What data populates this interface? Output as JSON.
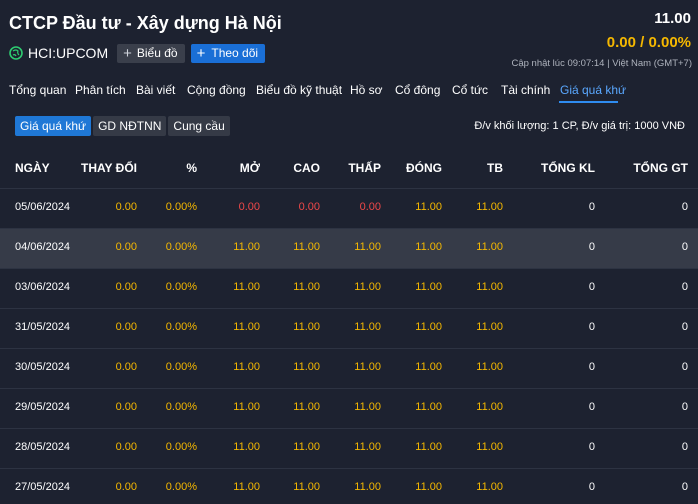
{
  "header": {
    "company_name": "CTCP Đầu tư - Xây dựng Hà Nội",
    "ticker": "HCI:UPCOM",
    "chart_button": "Biểu đồ",
    "follow_button": "Theo dõi",
    "price": "11.00",
    "change": "0.00 / 0.00%",
    "updated": "Cập nhật lúc  09:07:14 | Việt Nam (GMT+7)"
  },
  "tabs": [
    "Tổng quan",
    "Phân tích",
    "Bài viết",
    "Cộng đồng",
    "Biểu đồ kỹ thuật",
    "Hồ sơ",
    "Cổ đông",
    "Cổ tức",
    "Tài chính",
    "Giá quá khứ"
  ],
  "subtabs": [
    "Giá quá khứ",
    "GD NĐTNN",
    "Cung cầu"
  ],
  "unit_note": "Đ/v khối lượng: 1 CP, Đ/v giá trị: 1000 VNĐ",
  "columns": [
    "NGÀY",
    "THAY ĐỔI",
    "%",
    "MỞ",
    "CAO",
    "THẤP",
    "ĐÓNG",
    "TB",
    "TỔNG KL",
    "TỔNG GT"
  ],
  "rows": [
    [
      "05/06/2024",
      "0.00",
      "0.00%",
      "0.00",
      "0.00",
      "0.00",
      "11.00",
      "11.00",
      "0",
      "0"
    ],
    [
      "04/06/2024",
      "0.00",
      "0.00%",
      "11.00",
      "11.00",
      "11.00",
      "11.00",
      "11.00",
      "0",
      "0"
    ],
    [
      "03/06/2024",
      "0.00",
      "0.00%",
      "11.00",
      "11.00",
      "11.00",
      "11.00",
      "11.00",
      "0",
      "0"
    ],
    [
      "31/05/2024",
      "0.00",
      "0.00%",
      "11.00",
      "11.00",
      "11.00",
      "11.00",
      "11.00",
      "0",
      "0"
    ],
    [
      "30/05/2024",
      "0.00",
      "0.00%",
      "11.00",
      "11.00",
      "11.00",
      "11.00",
      "11.00",
      "0",
      "0"
    ],
    [
      "29/05/2024",
      "0.00",
      "0.00%",
      "11.00",
      "11.00",
      "11.00",
      "11.00",
      "11.00",
      "0",
      "0"
    ],
    [
      "28/05/2024",
      "0.00",
      "0.00%",
      "11.00",
      "11.00",
      "11.00",
      "11.00",
      "11.00",
      "0",
      "0"
    ],
    [
      "27/05/2024",
      "0.00",
      "0.00%",
      "11.00",
      "11.00",
      "11.00",
      "11.00",
      "11.00",
      "0",
      "0"
    ]
  ],
  "colors": {
    "accent": "#1f78d6",
    "change": "#f5b800",
    "down": "#ef4848",
    "bg": "#1d2230"
  },
  "icons": {
    "globe": "globe-icon",
    "plus": "plus-icon"
  }
}
